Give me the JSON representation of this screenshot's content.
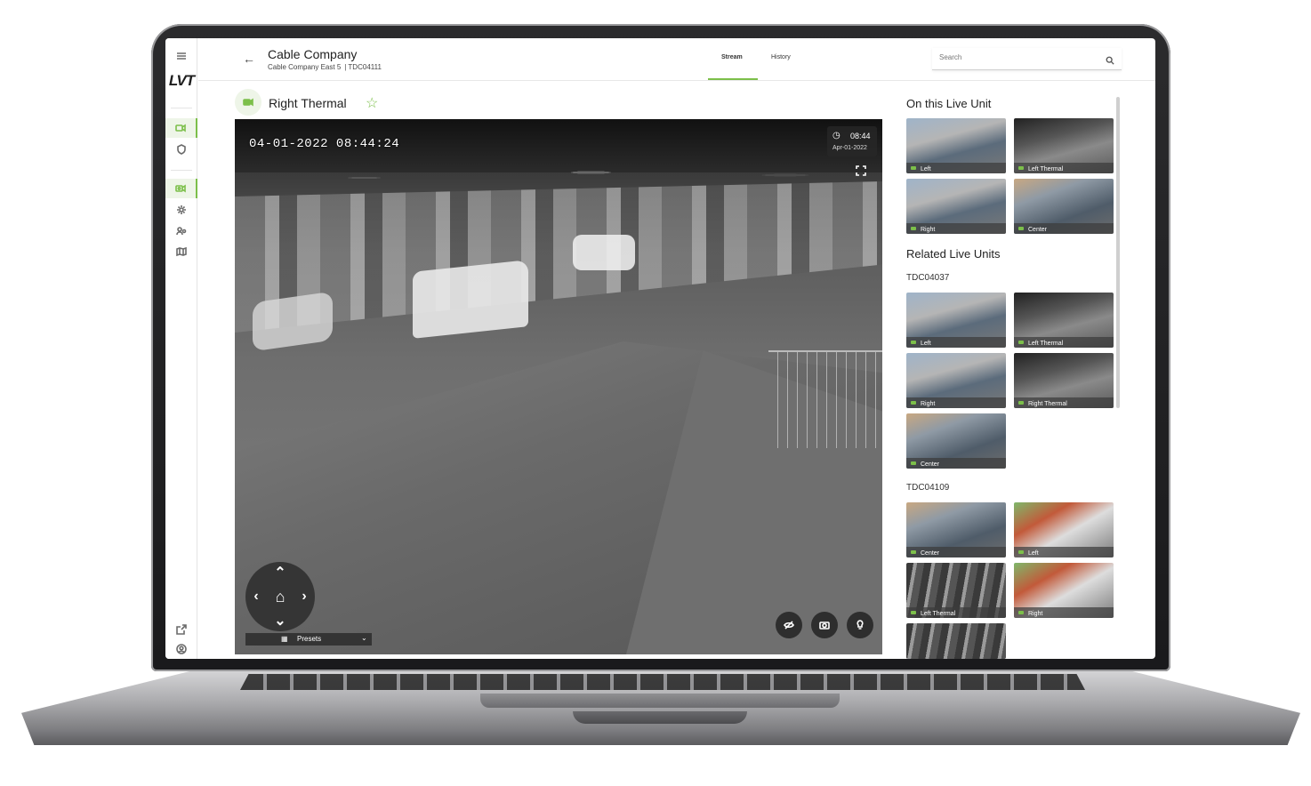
{
  "header": {
    "company": "Cable Company",
    "site": "Cable Company East 5",
    "unit": "| TDC04111",
    "tabs": [
      {
        "label": "Stream",
        "active": true
      },
      {
        "label": "History",
        "active": false
      }
    ],
    "search_placeholder": "Search"
  },
  "brand": {
    "logo": "LVT",
    "accent": "#7cbf4a"
  },
  "camera": {
    "title": "Right Thermal",
    "overlay_timestamp": "04-01-2022 08:44:24",
    "clock_time": "08:44",
    "clock_date": "Apr-01-2022",
    "presets_label": "Presets"
  },
  "panel": {
    "this_unit_heading": "On this Live Unit",
    "this_unit_thumbs": [
      "Left",
      "Left Thermal",
      "Right",
      "Center"
    ],
    "related_heading": "Related Live Units",
    "related": [
      {
        "unit": "TDC04037",
        "thumbs": [
          "Left",
          "Left Thermal",
          "Right",
          "Right Thermal",
          "Center"
        ]
      },
      {
        "unit": "TDC04109",
        "thumbs": [
          "Center",
          "Left",
          "Left Thermal",
          "Right",
          ""
        ]
      }
    ]
  },
  "icons": {
    "rail": [
      "menu-icon",
      "camera-icon",
      "shield-icon",
      "video-record-icon",
      "gear-icon",
      "users-icon",
      "map-icon",
      "external-link-icon",
      "account-icon"
    ],
    "video_tools": [
      "privacy-icon",
      "snapshot-icon",
      "light-icon"
    ]
  }
}
